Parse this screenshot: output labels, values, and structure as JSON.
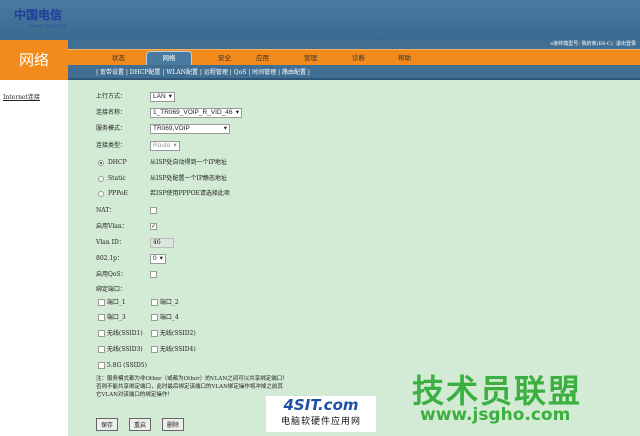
{
  "header": {
    "logo_text": "中国电信",
    "logo_sub": "CHINA TELECOM",
    "device_info": "e家终端型号: 我的家(E8-C)",
    "logout": "退出登录"
  },
  "section_title": "网络",
  "tabs": [
    {
      "label": "状态"
    },
    {
      "label": "网络",
      "active": true
    },
    {
      "label": "安全"
    },
    {
      "label": "应用"
    },
    {
      "label": "管理"
    },
    {
      "label": "诊断"
    },
    {
      "label": "帮助"
    }
  ],
  "subnav": "| 宽带设置 | DHCP配置 | WLAN配置 | 远程管理 | QoS | 时间管理 | 路由配置 |",
  "sidebar": {
    "item": "Internet连接"
  },
  "form": {
    "uplink_label": "上行方式：",
    "uplink_value": "LAN",
    "conn_name_label": "连接名称：",
    "conn_name_value": "1_TR069_VOIP_R_VID_46",
    "service_label": "服务模式：",
    "service_value": "TR069,VOIP",
    "conn_type_label": "连接类型：",
    "conn_type_value": "Route",
    "dhcp_label": "DHCP",
    "dhcp_desc": "从ISP处自动得到一个IP地址",
    "static_label": "Static",
    "static_desc": "从ISP处配置一个IP静态地址",
    "pppoe_label": "PPPoE",
    "pppoe_desc": "若ISP使用PPPOE请选择此项",
    "selected_mode": "DHCP",
    "nat_label": "NAT：",
    "nat_checked": false,
    "vlan_label": "启用Vlan：",
    "vlan_checked": true,
    "vlanid_label": "Vlan ID：",
    "vlanid_value": "46",
    "p8021_label": "802.1p：",
    "p8021_value": "0",
    "qos_label": "启用QoS：",
    "qos_checked": false,
    "bind_label": "绑定端口：",
    "ports": [
      "端口_1",
      "端口_2",
      "端口_3",
      "端口_4",
      "无线(SSID1)",
      "无线(SSID2)",
      "无线(SSID3)",
      "无线(SSID4)",
      "5.8G (SSID5)"
    ],
    "note": [
      "注：服务模式都为非Other（或都为Other）的VLAN之间可以共享绑定端口！",
      "否则不能共享绑定端口，此时最后绑定该端口的VLAN绑定操作将冲掉之前其",
      "它VLAN对该端口的绑定操作！"
    ],
    "save": "保存",
    "restart": "重启",
    "delete": "删除"
  },
  "watermarks": {
    "jsgho": "技术员联盟",
    "jsgho_url": "www.jsgho.com",
    "site4": "4SIT.com",
    "site4_sub": "电脑软硬件应用网"
  }
}
